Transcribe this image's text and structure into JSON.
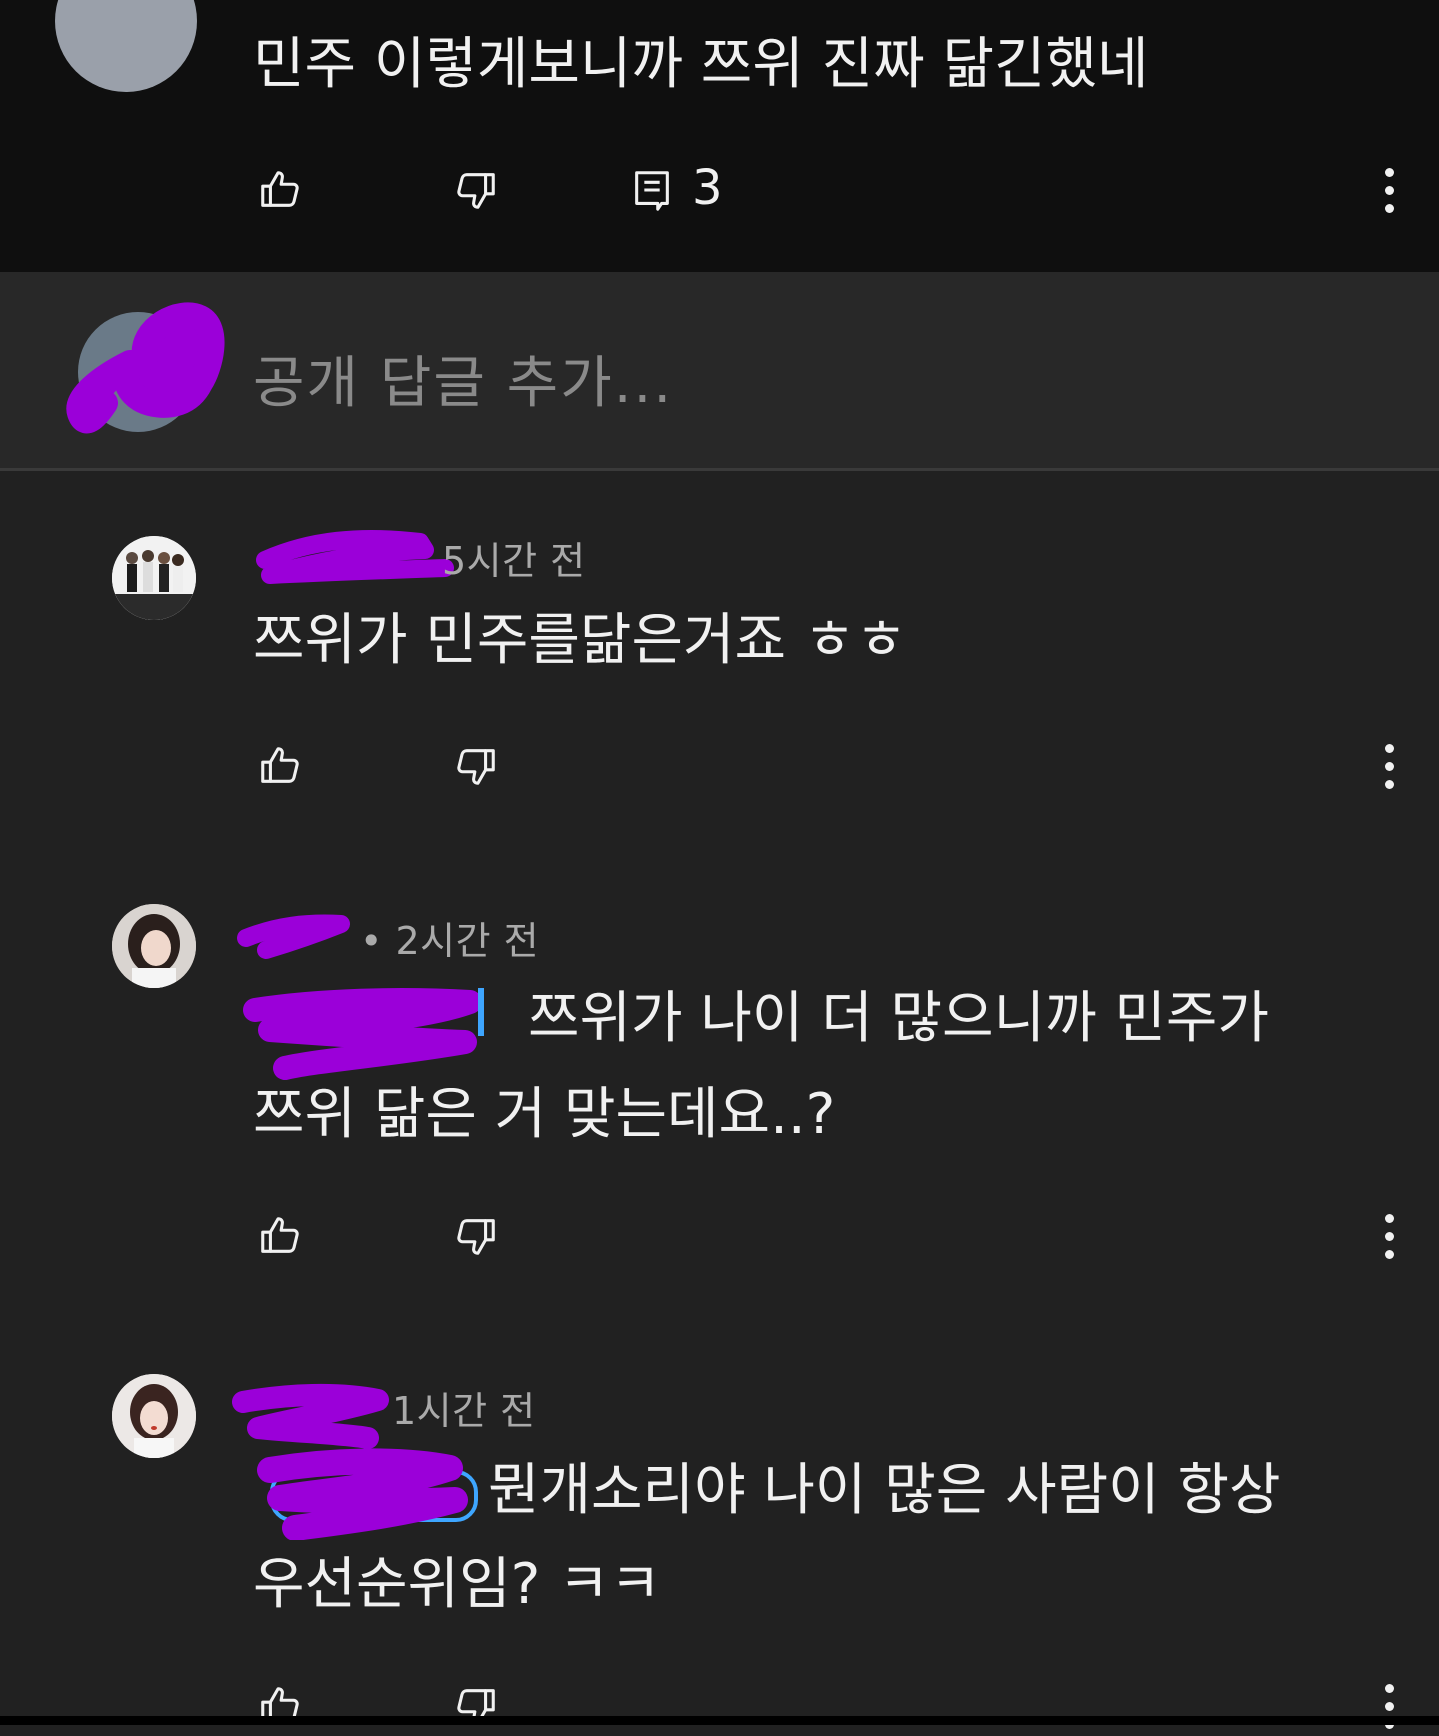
{
  "parent_comment": {
    "text": "민주 이렇게보니까 쯔위 진짜 닮긴했네",
    "reply_count": "3"
  },
  "reply_box": {
    "placeholder": "공개 답글 추가..."
  },
  "replies": [
    {
      "time": "5시간 전",
      "text": "쯔위가 민주를닮은거죠 ㅎㅎ"
    },
    {
      "time": "• 2시간 전",
      "line1": "쯔위가 나이 더 많으니까 민주가",
      "line2": "쯔위 닮은 거 맞는데요..?"
    },
    {
      "time": "1시간 전",
      "line1": "뭔개소리야 나이 많은 사람이 항상",
      "line2": "우선순위임? ㅋㅋ"
    }
  ],
  "colors": {
    "background": "#212121",
    "parent_background": "#0f0f0f",
    "reply_box_background": "#282828",
    "redaction": "#9b00d9",
    "mention": "#3ea6ff"
  },
  "icons": [
    "thumbs-up-icon",
    "thumbs-down-icon",
    "comment-icon",
    "more-vert-icon"
  ]
}
